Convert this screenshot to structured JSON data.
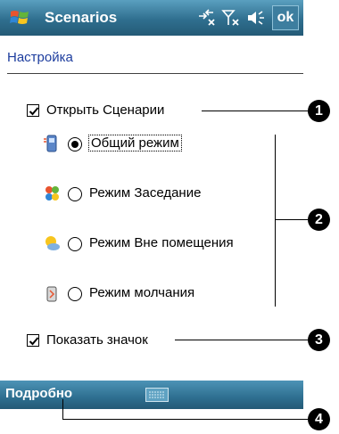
{
  "title_bar": {
    "app_title": "Scenarios",
    "ok_label": "ok",
    "icons": [
      "windows-start-icon",
      "connectivity-icon",
      "signal-icon",
      "volume-icon"
    ]
  },
  "page": {
    "heading": "Настройка"
  },
  "options": {
    "open_scenarios": {
      "label": "Открыть Сценарии",
      "checked": true
    },
    "show_icon": {
      "label": "Показать значок",
      "checked": true
    }
  },
  "modes": [
    {
      "label": "Общий режим",
      "selected": true,
      "icon": "phone-icon"
    },
    {
      "label": "Режим Заседание",
      "selected": false,
      "icon": "meeting-icon"
    },
    {
      "label": "Режим Вне помещения",
      "selected": false,
      "icon": "outdoor-icon"
    },
    {
      "label": "Режим молчания",
      "selected": false,
      "icon": "silent-icon"
    }
  ],
  "menu_bar": {
    "left_label": "Подробно",
    "icons": [
      "keyboard-icon"
    ]
  },
  "callouts": [
    "1",
    "2",
    "3",
    "4"
  ]
}
